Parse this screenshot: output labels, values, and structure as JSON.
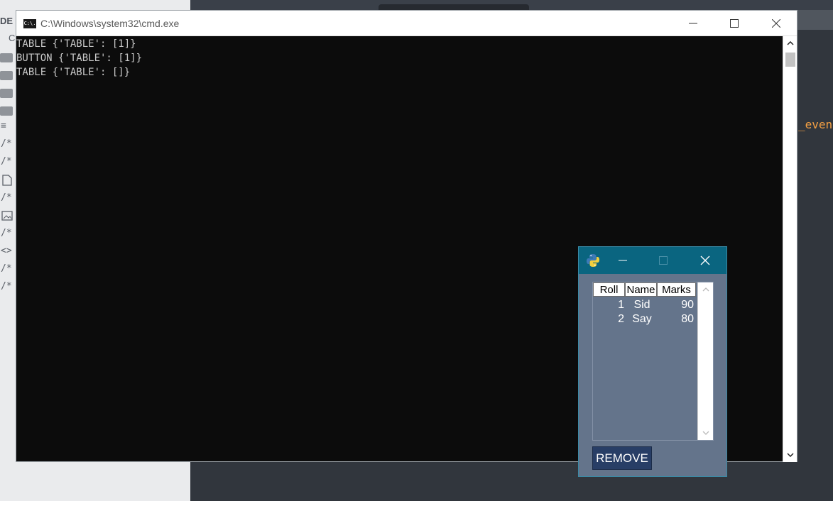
{
  "editor": {
    "sidebar_label": "DE",
    "sidebar_second_char": "C",
    "code_fragment": "_even",
    "sidebar_glyphs": [
      "/*",
      "/*",
      "/*",
      "/*",
      "/*",
      "/*",
      "<>"
    ]
  },
  "cmd": {
    "title": "C:\\Windows\\system32\\cmd.exe",
    "icon_text": "C:\\.",
    "lines": [
      "TABLE {'TABLE': [1]}",
      "BUTTON {'TABLE': [1]}",
      "TABLE {'TABLE': []}"
    ]
  },
  "popup": {
    "icon": "python-icon",
    "table": {
      "headers": [
        "Roll",
        "Name",
        "Marks"
      ],
      "rows": [
        [
          "1",
          "Sid",
          "90"
        ],
        [
          "2",
          "Say",
          "80"
        ]
      ]
    },
    "remove_label": "REMOVE"
  }
}
